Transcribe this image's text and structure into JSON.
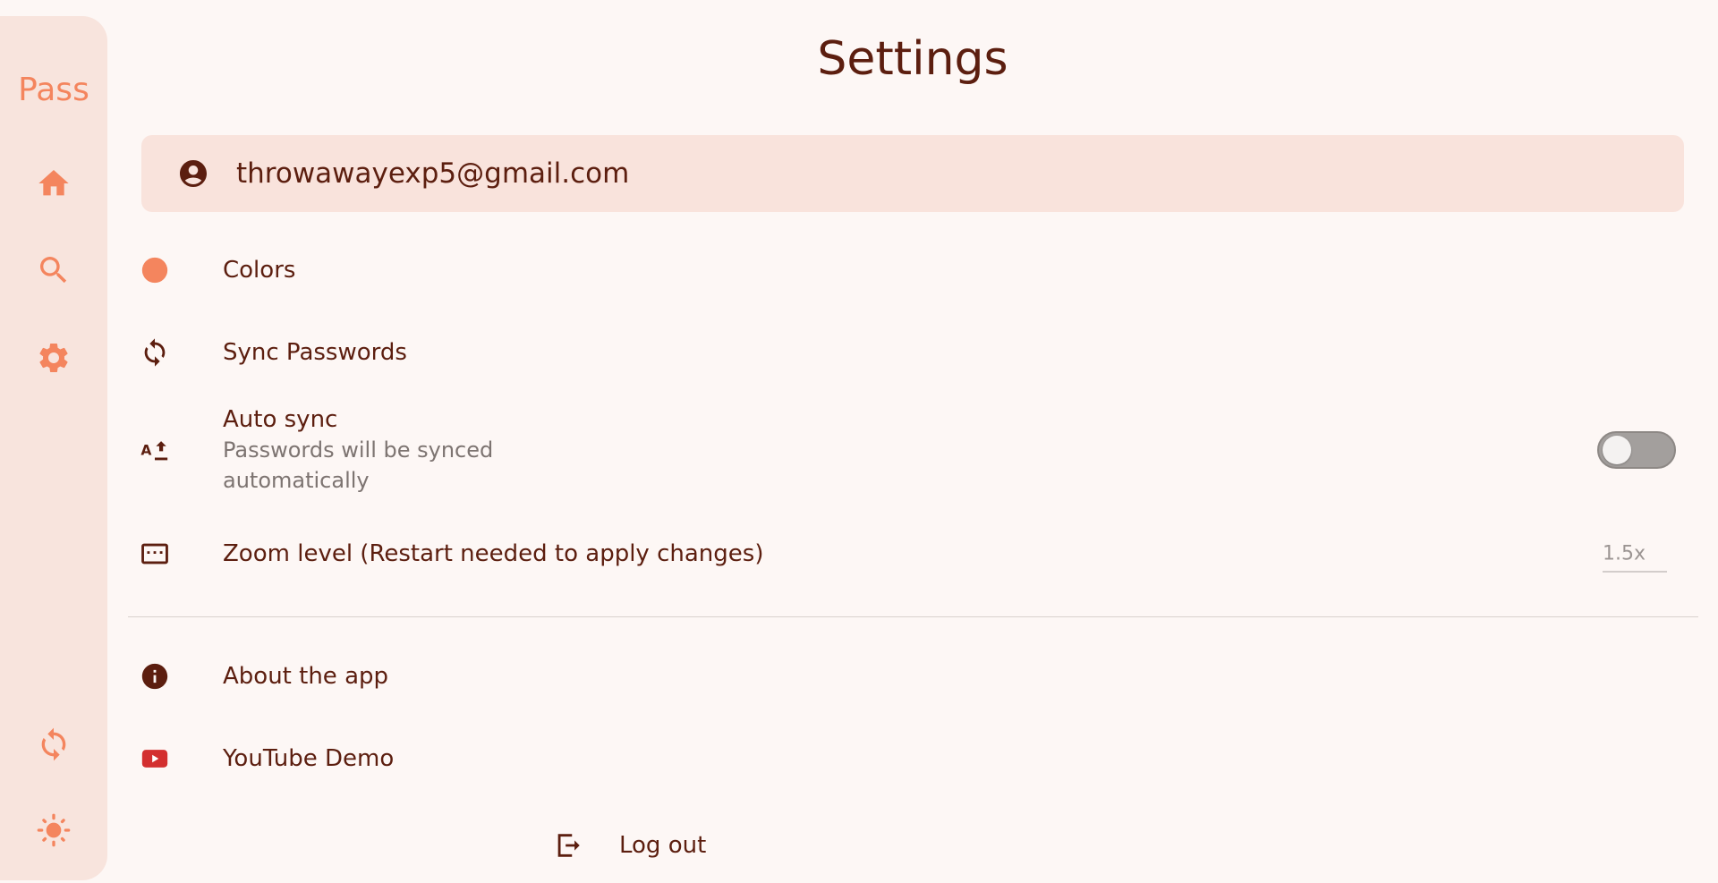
{
  "app": {
    "brand": "Pass",
    "colors": {
      "accent": "#f4855e",
      "text": "#5c1e0f",
      "rail_bg": "#f8e4dd",
      "page_bg": "#fdf7f5",
      "youtube_red": "#d32f2f"
    }
  },
  "nav": {
    "items": [
      {
        "icon": "home-icon"
      },
      {
        "icon": "search-icon"
      },
      {
        "icon": "gear-icon"
      }
    ],
    "bottom": [
      {
        "icon": "sync-icon"
      },
      {
        "icon": "sun-icon"
      }
    ]
  },
  "page": {
    "title": "Settings"
  },
  "account": {
    "email": "throwawayexp5@gmail.com",
    "icon": "account-circle-icon"
  },
  "settings": {
    "colors": {
      "label": "Colors",
      "icon": "color-dot-icon"
    },
    "sync": {
      "label": "Sync Passwords",
      "icon": "sync-icon"
    },
    "auto_sync": {
      "title": "Auto sync",
      "subtitle": "Passwords will be synced automatically",
      "icon": "upload-text-icon",
      "enabled": false
    },
    "zoom": {
      "label": "Zoom level (Restart needed to apply changes)",
      "value": "1.5x",
      "icon": "keyboard-icon"
    },
    "about": {
      "label": "About the app",
      "icon": "info-icon"
    },
    "youtube": {
      "label": "YouTube Demo",
      "icon": "youtube-icon"
    },
    "logout": {
      "label": "Log out",
      "icon": "logout-icon"
    }
  }
}
